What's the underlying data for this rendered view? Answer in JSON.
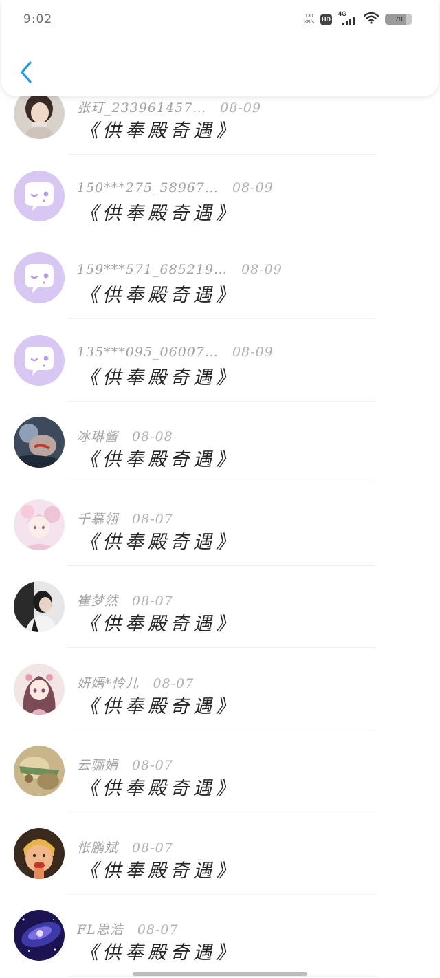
{
  "status_bar": {
    "time": "9:02",
    "net_speed_value": "130",
    "net_speed_unit": "KB/s",
    "hd_label": "HD",
    "network_type": "4G",
    "battery_level": "78",
    "battery_fraction": 0.78
  },
  "header": {
    "back_icon": "chevron-left-icon",
    "accent_color": "#1a9be8"
  },
  "messages": [
    {
      "name": "张玎_233961457…",
      "time": "08-09",
      "text": "《供奉殿奇遇》",
      "avatar": "photo-girl"
    },
    {
      "name": "150***275_58967…",
      "time": "08-09",
      "text": "《供奉殿奇遇》",
      "avatar": "default-chat"
    },
    {
      "name": "159***571_685219…",
      "time": "08-09",
      "text": "《供奉殿奇遇》",
      "avatar": "default-chat"
    },
    {
      "name": "135***095_06007…",
      "time": "08-09",
      "text": "《供奉殿奇遇》",
      "avatar": "default-chat"
    },
    {
      "name": "冰琳酱",
      "time": "08-08",
      "text": "《供奉殿奇遇》",
      "avatar": "anime-dark"
    },
    {
      "name": "千慕翎",
      "time": "08-07",
      "text": "《供奉殿奇遇》",
      "avatar": "anime-pink"
    },
    {
      "name": "崔梦然",
      "time": "08-07",
      "text": "《供奉殿奇遇》",
      "avatar": "photo-dark"
    },
    {
      "name": "妍嫣*怜儿",
      "time": "08-07",
      "text": "《供奉殿奇遇》",
      "avatar": "anime-rose"
    },
    {
      "name": "云骊娟",
      "time": "08-07",
      "text": "《供奉殿奇遇》",
      "avatar": "photo-gold"
    },
    {
      "name": "怅鹏斌",
      "time": "08-07",
      "text": "《供奉殿奇遇》",
      "avatar": "photo-child"
    },
    {
      "name": "FL思浩",
      "time": "08-07",
      "text": "《供奉殿奇遇》",
      "avatar": "galaxy"
    }
  ],
  "colors": {
    "default_avatar_bg": "#d8c6f3",
    "default_avatar_bubble": "#ffffff",
    "default_avatar_dot": "#b898e8"
  }
}
